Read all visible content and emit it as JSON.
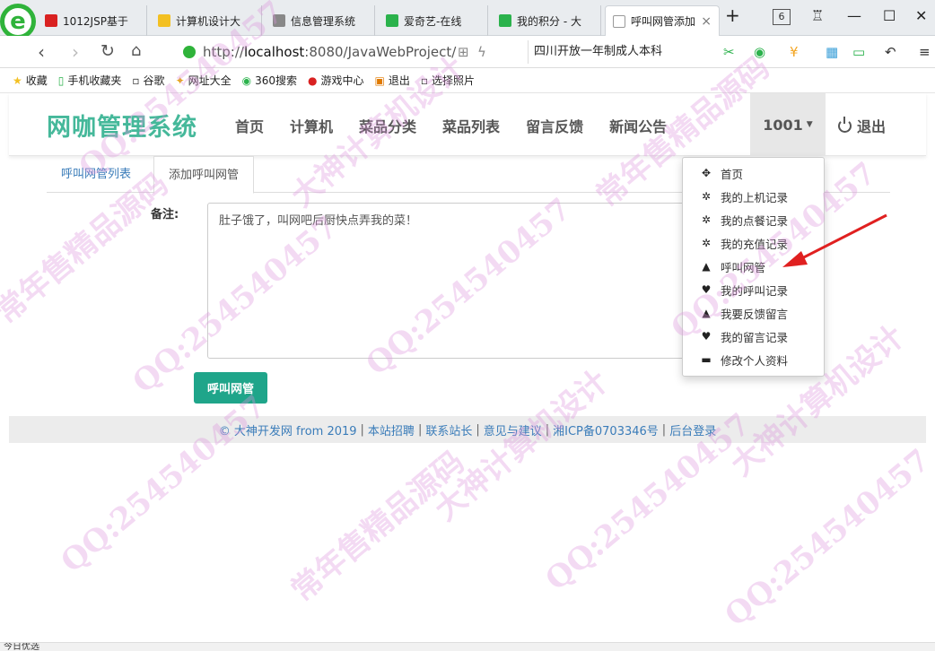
{
  "browser": {
    "tabs": [
      {
        "title": "1012JSP基于",
        "color": "#d92121"
      },
      {
        "title": "计算机设计大",
        "color": "#f3c022"
      },
      {
        "title": "信息管理系统",
        "color": "#888888"
      },
      {
        "title": "爱奇艺-在线",
        "color": "#2bb24c"
      },
      {
        "title": "我的积分 - 大",
        "color": "#2bb24c"
      },
      {
        "title": "呼叫网管添加",
        "color": "#999999"
      }
    ],
    "new_tab": "+",
    "tab_count": "6",
    "url_prefix": "http://",
    "url_host": "localhost",
    "url_path": ":8080/JavaWebProject/",
    "search_text": "四川开放一年制成人本科",
    "status_text": "今日优选"
  },
  "bookmarks": [
    {
      "label": "收藏",
      "icon": "★"
    },
    {
      "label": "手机收藏夹",
      "icon": "▯"
    },
    {
      "label": "谷歌",
      "icon": "▫"
    },
    {
      "label": "网址大全",
      "icon": "✦"
    },
    {
      "label": "360搜索",
      "icon": "◉"
    },
    {
      "label": "游戏中心",
      "icon": "●"
    },
    {
      "label": "退出",
      "icon": "▣"
    },
    {
      "label": "选择照片",
      "icon": "▫"
    }
  ],
  "site": {
    "brand": "网咖管理系统",
    "menu": [
      "首页",
      "计算机",
      "菜品分类",
      "菜品列表",
      "留言反馈",
      "新闻公告"
    ],
    "user": "1001",
    "logout": "退出"
  },
  "subtabs": {
    "list": "呼叫网管列表",
    "add": "添加呼叫网管"
  },
  "form": {
    "remark_label": "备注:",
    "remark_value": "肚子饿了，叫网吧后厨快点弄我的菜！",
    "submit": "呼叫网管"
  },
  "dropdown": [
    {
      "label": "首页",
      "icon": "✥"
    },
    {
      "label": "我的上机记录",
      "icon": "✲"
    },
    {
      "label": "我的点餐记录",
      "icon": "✲"
    },
    {
      "label": "我的充值记录",
      "icon": "✲"
    },
    {
      "label": "呼叫网管",
      "icon": "▲"
    },
    {
      "label": "我的呼叫记录",
      "icon": "♥"
    },
    {
      "label": "我要反馈留言",
      "icon": "▲"
    },
    {
      "label": "我的留言记录",
      "icon": "♥"
    },
    {
      "label": "修改个人资料",
      "icon": "▬"
    }
  ],
  "footer": {
    "copyright": "© 大神开发网 from 2019",
    "links": [
      "本站招聘",
      "联系站长",
      "意见与建议",
      "湘ICP备0703346号",
      "后台登录"
    ]
  },
  "watermark": [
    "QQ:254540457",
    "大神计算机设计",
    "常年售精品源码"
  ]
}
